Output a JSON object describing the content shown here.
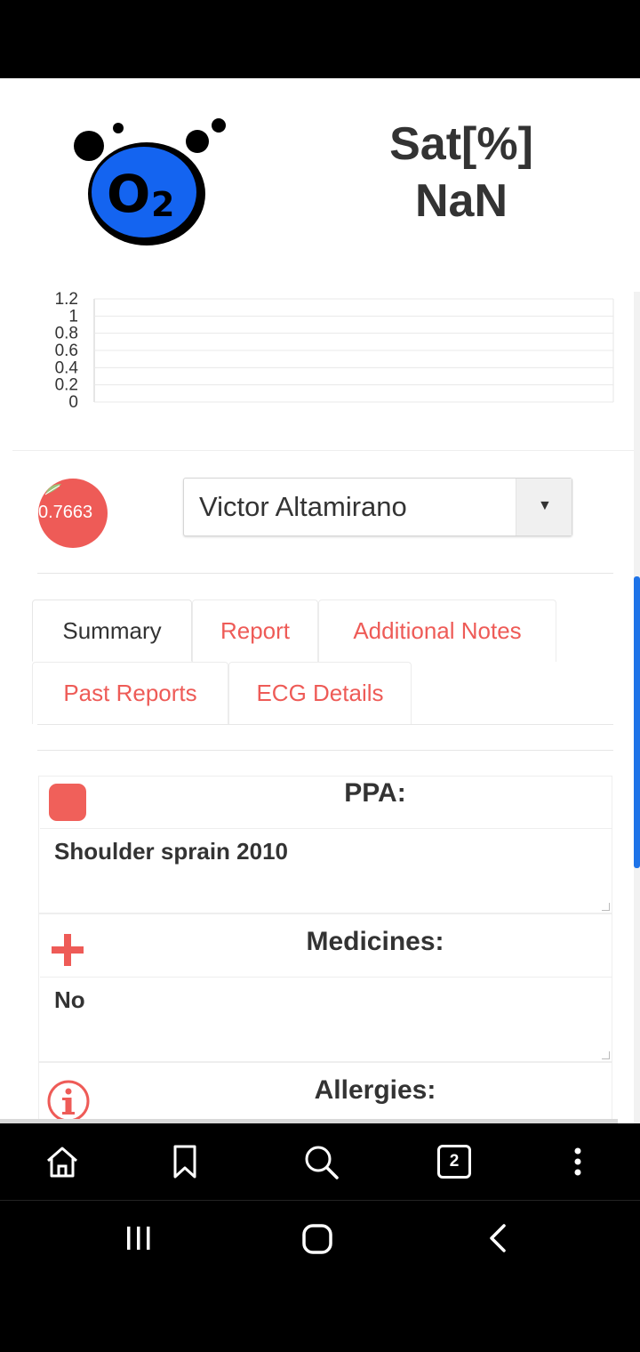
{
  "monitor": {
    "title": "Sat[%]",
    "value": "NaN",
    "logo_text": "O",
    "logo_sub": "2"
  },
  "chart_data": {
    "type": "line",
    "x": [],
    "series": [
      {
        "values": []
      }
    ],
    "ylim": [
      0,
      1.2
    ],
    "yticks": [
      "1.2",
      "1",
      "0.8",
      "0.6",
      "0.4",
      "0.2",
      "0"
    ],
    "grid": true
  },
  "patient": {
    "avatar_value": "0.7663",
    "name": "Victor Altamirano",
    "dropdown_arrow": "▼"
  },
  "tabs": [
    {
      "label": "Summary",
      "active": true
    },
    {
      "label": "Report",
      "active": false
    },
    {
      "label": "Additional Notes",
      "active": false
    },
    {
      "label": "Past Reports",
      "active": false
    },
    {
      "label": "ECG Details",
      "active": false
    }
  ],
  "sections": {
    "ppa": {
      "title": "PPA:",
      "value": "Shoulder sprain 2010"
    },
    "medicines": {
      "title": "Medicines:",
      "value": "No"
    },
    "allergies": {
      "title": "Allergies:"
    }
  },
  "browser": {
    "tab_count": "2",
    "icons": [
      "home-icon",
      "bookmark-icon",
      "search-icon",
      "tabs-icon",
      "more-icon"
    ]
  },
  "colors": {
    "accent": "#ee5b57",
    "o2_blue": "#1464f0",
    "scroll_blue": "#1e73e8"
  }
}
